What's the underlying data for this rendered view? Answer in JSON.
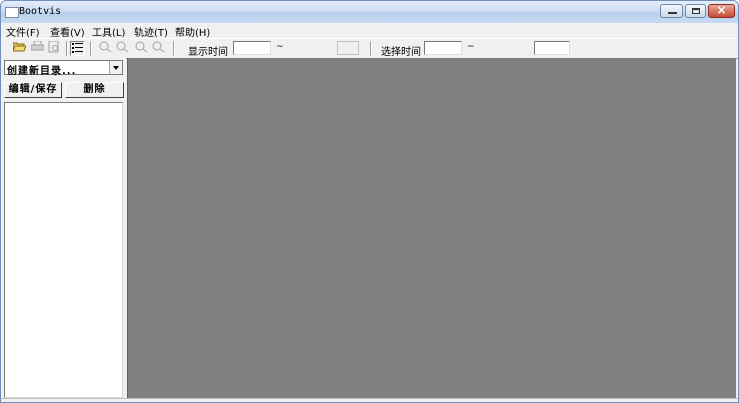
{
  "window": {
    "title": "Bootvis"
  },
  "menu": [
    {
      "label": "文件(F)"
    },
    {
      "label": "查看(V)"
    },
    {
      "label": "工具(L)"
    },
    {
      "label": "轨迹(T)"
    },
    {
      "label": "帮助(H)"
    }
  ],
  "toolbar": {
    "display_time_label": "显示时间",
    "select_time_label": "选择时间",
    "tilde_1": "~",
    "tilde_2": "~",
    "icons": [
      "open-folder-icon",
      "print-icon",
      "print-preview-icon",
      "list-icon",
      "zoom-in-icon",
      "zoom-out-icon",
      "zoom-fit-icon",
      "zoom-reset-icon"
    ]
  },
  "left_pane": {
    "combo_value": "创建新目录...",
    "edit_save_label": "编辑/保存",
    "delete_label": "删除"
  },
  "colors": {
    "canvas": "#808080",
    "titlebar": "#c9dbf3",
    "close": "#c74a34"
  }
}
